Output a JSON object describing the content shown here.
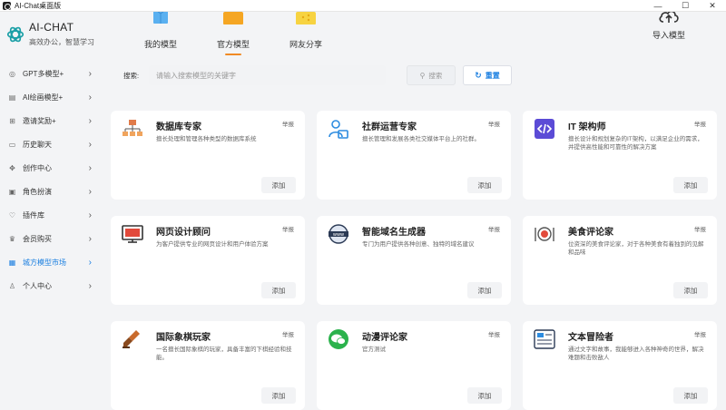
{
  "window": {
    "title": "AI-Chat桌面版",
    "controls": [
      "—",
      "☐",
      "✕"
    ]
  },
  "brand": {
    "name": "AI-CHAT",
    "slogan": "高效办公，智慧学习",
    "logo_icon": "openai-knot-icon"
  },
  "sidebar": {
    "items": [
      {
        "label": "GPT多模型+",
        "icon": "globe-icon",
        "active": false
      },
      {
        "label": "AI绘画模型+",
        "icon": "image-icon",
        "active": false
      },
      {
        "label": "邀请奖励+",
        "icon": "gift-icon",
        "active": false
      },
      {
        "label": "历史聊天",
        "icon": "chat-icon",
        "active": false
      },
      {
        "label": "创作中心",
        "icon": "gamepad-icon",
        "active": false
      },
      {
        "label": "角色扮演",
        "icon": "mask-icon",
        "active": false
      },
      {
        "label": "插件库",
        "icon": "plugin-icon",
        "active": false
      },
      {
        "label": "会员购买",
        "icon": "crown-icon",
        "active": false
      },
      {
        "label": "城方模型市场",
        "icon": "store-icon",
        "active": true
      },
      {
        "label": "个人中心",
        "icon": "user-icon",
        "active": false
      }
    ],
    "accent_color": "#1b7fe0"
  },
  "tabs": [
    {
      "label": "我的模型",
      "active": false,
      "icon_color": "#5ab0f0"
    },
    {
      "label": "官方模型",
      "active": true,
      "icon_color": "#f5a623"
    },
    {
      "label": "网友分享",
      "active": false,
      "icon_color": "#f7d341"
    }
  ],
  "import_button": {
    "label": "导入模型",
    "icon": "cloud-upload-icon"
  },
  "search": {
    "label": "搜索:",
    "placeholder": "请输入搜索模型的关键字",
    "search_button": "搜索",
    "reset_button": "重置"
  },
  "cards": [
    {
      "title": "数据库专家",
      "desc": "擅长处理和管理各种类型的数据库系统",
      "report": "举报",
      "add": "添加",
      "icon": "database-network-icon"
    },
    {
      "title": "社群运营专家",
      "desc": "擅长管理和发展各类社交媒体平台上的社群。",
      "report": "举报",
      "add": "添加",
      "icon": "user-folder-icon"
    },
    {
      "title": "IT 架构师",
      "desc": "擅长设计和规划复杂的IT架构，以满足企业的需求，并提供高性能和可靠性的解决方案",
      "report": "举报",
      "add": "添加",
      "icon": "code-brackets-icon"
    },
    {
      "title": "网页设计顾问",
      "desc": "为客户提供专业的网页设计和用户体验方案",
      "report": "举报",
      "add": "添加",
      "icon": "monitor-icon"
    },
    {
      "title": "智能域名生成器",
      "desc": "专门为用户提供各种创意、独特的域名建议",
      "report": "举报",
      "add": "添加",
      "icon": "www-globe-icon"
    },
    {
      "title": "美食评论家",
      "desc": "位资深的美食评论家，对于各种美食有着独到的见解和品味",
      "report": "举报",
      "add": "添加",
      "icon": "plate-cutlery-icon"
    },
    {
      "title": "国际象棋玩家",
      "desc": "一名擅长国际象棋的玩家，具备丰富的下棋经验和技能。",
      "report": "举报",
      "add": "添加",
      "icon": "chess-piece-icon"
    },
    {
      "title": "动漫评论家",
      "desc": "官方测试",
      "report": "举报",
      "add": "添加",
      "icon": "wechat-icon"
    },
    {
      "title": "文本冒险者",
      "desc": "通过文字和故事，我能够进入各种神奇的世界，解决难题和击败敌人",
      "report": "举报",
      "add": "添加",
      "icon": "text-document-icon"
    }
  ]
}
